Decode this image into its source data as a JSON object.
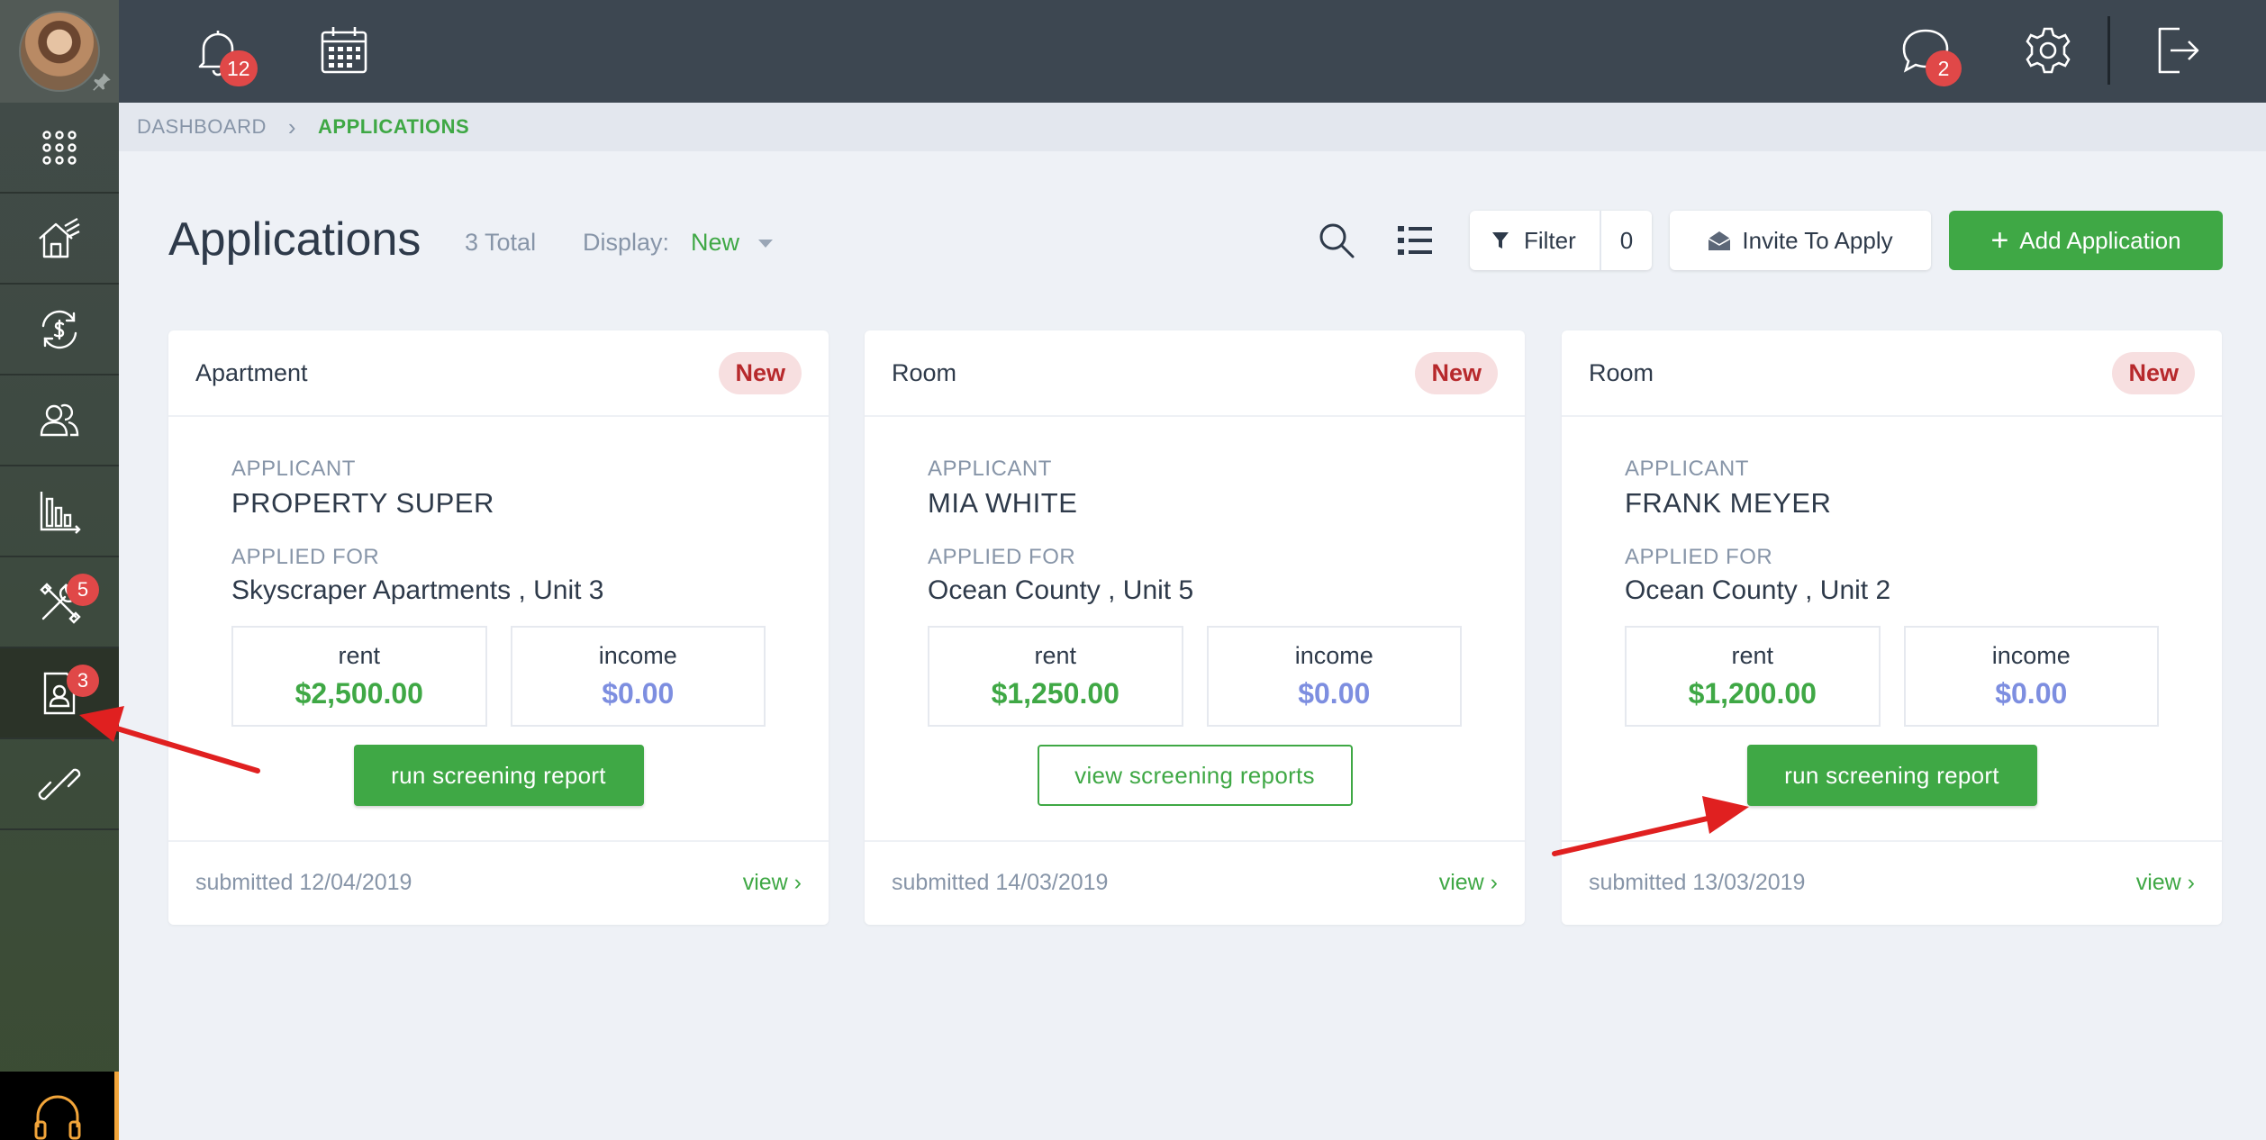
{
  "topbar": {
    "notifications_count": "12",
    "messages_count": "2"
  },
  "sidebar": {
    "maintenance_badge": "5",
    "applications_badge": "3"
  },
  "breadcrumb": {
    "home": "DASHBOARD",
    "current": "APPLICATIONS"
  },
  "header": {
    "title": "Applications",
    "total": "3 Total",
    "display_label": "Display:",
    "display_value": "New",
    "filter_label": "Filter",
    "filter_count": "0",
    "invite_label": "Invite To Apply",
    "add_label": "Add Application"
  },
  "cards": [
    {
      "type": "Apartment",
      "badge": "New",
      "applicant_label": "APPLICANT",
      "applicant_name": "PROPERTY SUPER",
      "applied_label": "APPLIED FOR",
      "applied_for": "Skyscraper Apartments , Unit 3",
      "rent_label": "rent",
      "rent": "$2,500.00",
      "income_label": "income",
      "income": "$0.00",
      "action": "run screening report",
      "submitted": "submitted 12/04/2019",
      "view": "view"
    },
    {
      "type": "Room",
      "badge": "New",
      "applicant_label": "APPLICANT",
      "applicant_name": "MIA WHITE",
      "applied_label": "APPLIED FOR",
      "applied_for": "Ocean County , Unit 5",
      "rent_label": "rent",
      "rent": "$1,250.00",
      "income_label": "income",
      "income": "$0.00",
      "action": "view screening reports",
      "submitted": "submitted 14/03/2019",
      "view": "view"
    },
    {
      "type": "Room",
      "badge": "New",
      "applicant_label": "APPLICANT",
      "applicant_name": "FRANK MEYER",
      "applied_label": "APPLIED FOR",
      "applied_for": "Ocean County , Unit 2",
      "rent_label": "rent",
      "rent": "$1,200.00",
      "income_label": "income",
      "income": "$0.00",
      "action": "run screening report",
      "submitted": "submitted 13/03/2019",
      "view": "view"
    }
  ],
  "colors": {
    "accent_green": "#3fa845",
    "badge_red": "#e04848",
    "topbar": "#3d4751",
    "income_blue": "#7d8ee0",
    "annotation_arrow": "#e02020"
  },
  "icons": {
    "sidebar": [
      "apps-grid-icon",
      "property-house-icon",
      "payments-cycle-icon",
      "people-icon",
      "reports-chart-icon",
      "maintenance-tools-icon",
      "applications-icon",
      "link-icon",
      "support-headset-icon"
    ],
    "topbar": [
      "bell-icon",
      "calendar-icon",
      "chat-icon",
      "gear-icon",
      "logout-icon"
    ]
  }
}
